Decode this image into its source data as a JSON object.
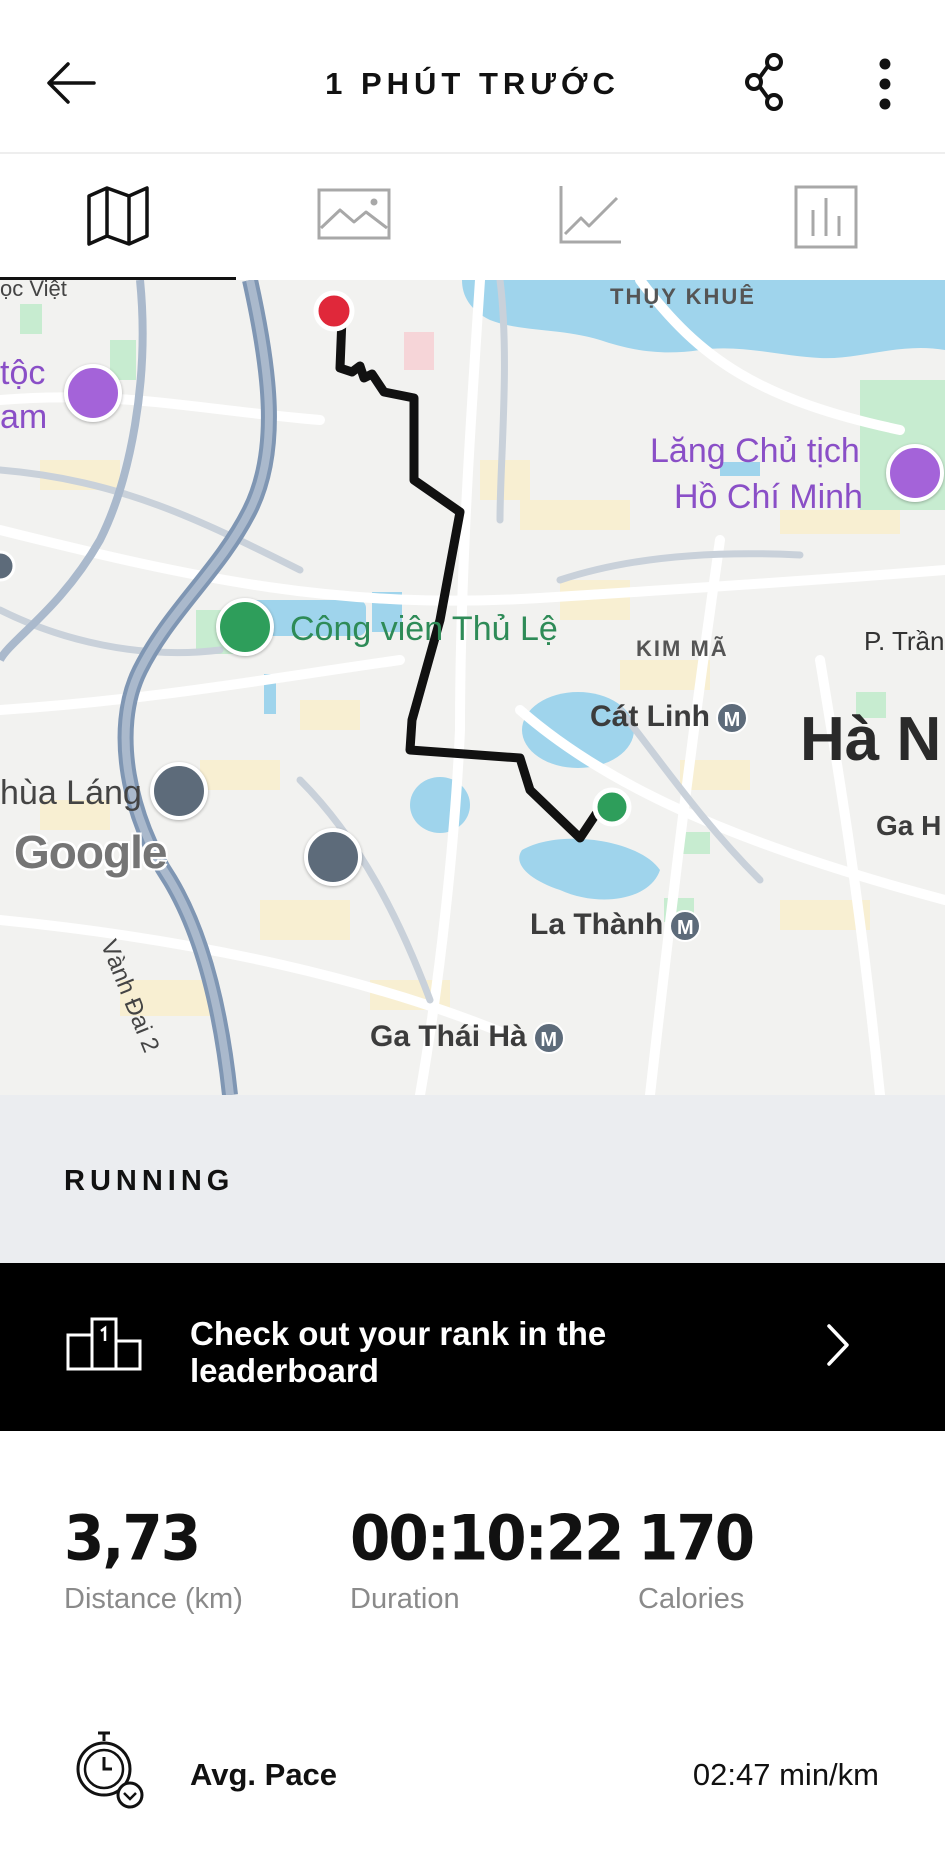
{
  "header": {
    "title": "1 PHÚT TRƯỚC",
    "back_icon": "arrow-left-icon",
    "share_icon": "share-icon",
    "more_icon": "more-vertical-icon"
  },
  "tabs": [
    {
      "name": "map",
      "icon": "map-icon",
      "selected": true
    },
    {
      "name": "photo",
      "icon": "image-icon",
      "selected": false
    },
    {
      "name": "chart",
      "icon": "line-chart-icon",
      "selected": false
    },
    {
      "name": "stats",
      "icon": "bar-chart-icon",
      "selected": false
    }
  ],
  "map": {
    "labels": {
      "oc_viet": "ọc Việt",
      "thuy_khue": "THỤY KHUÊ",
      "toc_nam_1": "tộc",
      "toc_nam_2": "am",
      "lang_1": "Lăng Chủ tịch",
      "lang_2": "Hồ Chí Minh",
      "cong_vien": "Công viên Thủ Lệ",
      "kim_ma": "KIM MÃ",
      "p_tran": "P. Trần",
      "cat_linh": "Cát Linh",
      "ha_noi": "Hà N",
      "chua_lang": "hùa Láng",
      "ga_h": "Ga H",
      "la_thanh": "La Thành",
      "vanh_dai": "Vành Đai 2",
      "ga_thai_ha": "Ga Thái Hà",
      "metro": "M",
      "google": "Google"
    },
    "colors": {
      "route": "#111111",
      "start": "#2e9e5b",
      "end": "#e0283a",
      "water": "#9fd4ec",
      "park": "#c7ecd0"
    }
  },
  "activity": {
    "type_label": "RUNNING"
  },
  "leaderboard": {
    "text": "Check out your rank in the leaderboard",
    "icon": "podium-icon",
    "chevron_icon": "chevron-right-icon"
  },
  "stats": {
    "distance_value": "3,73",
    "distance_label": "Distance (km)",
    "duration_value": "00:10:22",
    "duration_label": "Duration",
    "calories_value": "170",
    "calories_label": "Calories"
  },
  "pace": {
    "label": "Avg. Pace",
    "value": "02:47 min/km",
    "icon": "stopwatch-icon"
  }
}
